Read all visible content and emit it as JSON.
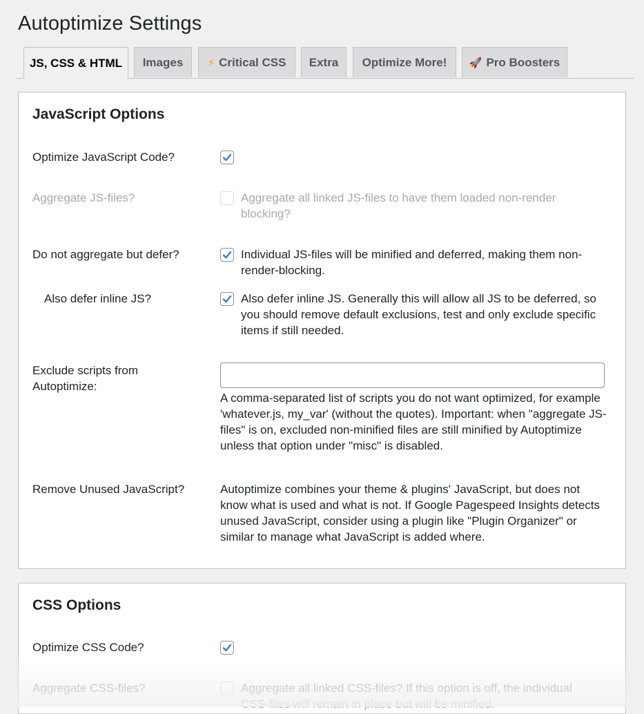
{
  "page": {
    "title": "Autoptimize Settings"
  },
  "tabs": [
    {
      "label": "JS, CSS & HTML",
      "icon": ""
    },
    {
      "label": "Images",
      "icon": ""
    },
    {
      "label": "Critical CSS",
      "icon": "⚡"
    },
    {
      "label": "Extra",
      "icon": ""
    },
    {
      "label": "Optimize More!",
      "icon": ""
    },
    {
      "label": "Pro Boosters",
      "icon": "🚀"
    }
  ],
  "js": {
    "title": "JavaScript Options",
    "optimize_label": "Optimize JavaScript Code?",
    "optimize_checked": true,
    "aggregate_label": "Aggregate JS-files?",
    "aggregate_checked": false,
    "aggregate_desc": "Aggregate all linked JS-files to have them loaded non-render blocking?",
    "defer_label": "Do not aggregate but defer?",
    "defer_checked": true,
    "defer_desc": "Individual JS-files will be minified and deferred, making them non-render-blocking.",
    "inline_label": "Also defer inline JS?",
    "inline_checked": true,
    "inline_desc": "Also defer inline JS. Generally this will allow all JS to be deferred, so you should remove default exclusions, test and only exclude specific items if still needed.",
    "exclude_label": "Exclude scripts from Autoptimize:",
    "exclude_value": "",
    "exclude_desc": "A comma-separated list of scripts you do not want optimized, for example 'whatever.js, my_var' (without the quotes). Important: when \"aggregate JS-files\" is on, excluded non-minified files are still minified by Autoptimize unless that option under \"misc\" is disabled.",
    "unused_label": "Remove Unused JavaScript?",
    "unused_desc": "Autoptimize combines your theme & plugins' JavaScript, but does not know what is used and what is not. If Google Pagespeed Insights detects unused JavaScript, consider using a plugin like \"Plugin Organizer\" or similar to manage what JavaScript is added where."
  },
  "css": {
    "title": "CSS Options",
    "optimize_label": "Optimize CSS Code?",
    "optimize_checked": true,
    "aggregate_label": "Aggregate CSS-files?",
    "aggregate_checked": false,
    "aggregate_desc": "Aggregate all linked CSS-files? If this option is off, the individual CSS-files will remain in place but will be minified."
  },
  "colors": {
    "accent": "#2271b1",
    "checkmark": "#3582c4"
  }
}
